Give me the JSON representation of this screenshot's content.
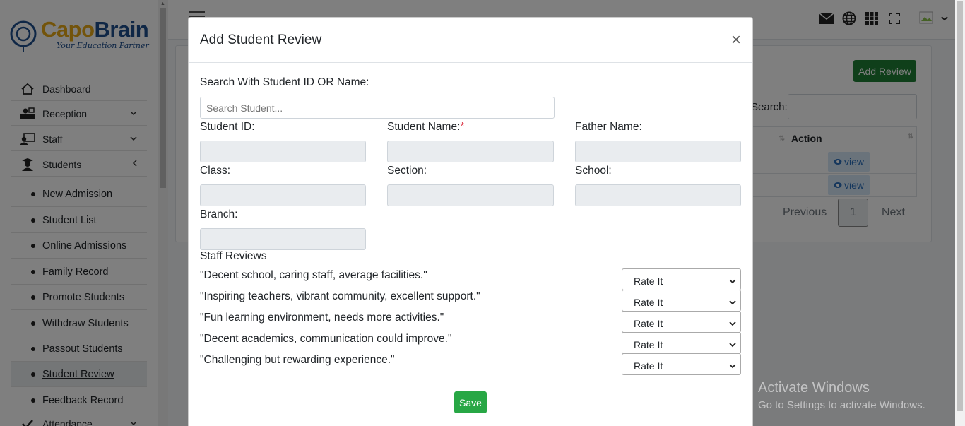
{
  "brand": {
    "name_part1": "Capo",
    "name_part2": "Brain",
    "tagline": "Your Education Partner"
  },
  "sidebar": {
    "items": [
      {
        "label": "Dashboard"
      },
      {
        "label": "Reception"
      },
      {
        "label": "Staff"
      },
      {
        "label": "Students"
      }
    ],
    "students_sub": [
      "New Admission",
      "Student List",
      "Online Admissions",
      "Family Record",
      "Promote Students",
      "Withdraw Students",
      "Passout Students",
      "Student Review",
      "Feedback Record"
    ],
    "attendance": "Attendance"
  },
  "page": {
    "add_review_label": "Add Review",
    "search_label": "Search:",
    "table_header_action": "Action",
    "view_label": "view",
    "previous_label": "Previous",
    "next_label": "Next",
    "current_page": "1"
  },
  "modal": {
    "title": "Add Student Review",
    "close": "×",
    "search_label": "Search With Student ID OR Name:",
    "search_placeholder": "Search Student...",
    "fields": {
      "student_id": "Student ID:",
      "student_name": "Student Name:",
      "required_mark": "*",
      "father_name": "Father Name:",
      "class": "Class:",
      "section": "Section:",
      "school": "School:",
      "branch": "Branch:"
    },
    "staff_reviews_label": "Staff Reviews",
    "reviews": [
      "\"Decent school, caring staff, average facilities.\"",
      "\"Inspiring teachers, vibrant community, excellent support.\"",
      "\"Fun learning environment, needs more activities.\"",
      "\"Decent academics, communication could improve.\"",
      "\"Challenging but rewarding experience.\""
    ],
    "rate_placeholder": "Rate It",
    "save_label": "Save"
  },
  "watermark": {
    "line1": "Activate Windows",
    "line2": "Go to Settings to activate Windows."
  }
}
